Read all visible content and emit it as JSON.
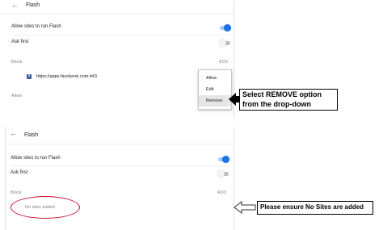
{
  "top_panel": {
    "back_icon": "arrow-left-icon",
    "title": "Flash",
    "allow_label": "Allow sites to run Flash",
    "allow_on": true,
    "ask_label": "Ask first",
    "ask_on": false,
    "block_label": "Block",
    "add_label": "ADD",
    "site_url": "https://apps.facebook.com:443",
    "allow_section_label": "Allow",
    "menu": {
      "items": [
        "Allow",
        "Edit",
        "Remove"
      ],
      "selected": "Remove"
    }
  },
  "callout_top": {
    "line1": "Select REMOVE option",
    "line2": "from the drop-down"
  },
  "bottom_panel": {
    "back_icon": "arrow-left-icon",
    "title": "Flash",
    "allow_label": "Allow sites to run Flash",
    "allow_on": true,
    "ask_label": "Ask first",
    "ask_on": false,
    "block_label": "Block",
    "add_label": "ADD",
    "empty_text": "No sites added"
  },
  "callout_bottom": {
    "text": "Please ensure No Sites are added"
  },
  "colors": {
    "toggle_on": "#1a73e8",
    "highlight_ellipse": "#c8102e",
    "facebook": "#3b5998"
  }
}
